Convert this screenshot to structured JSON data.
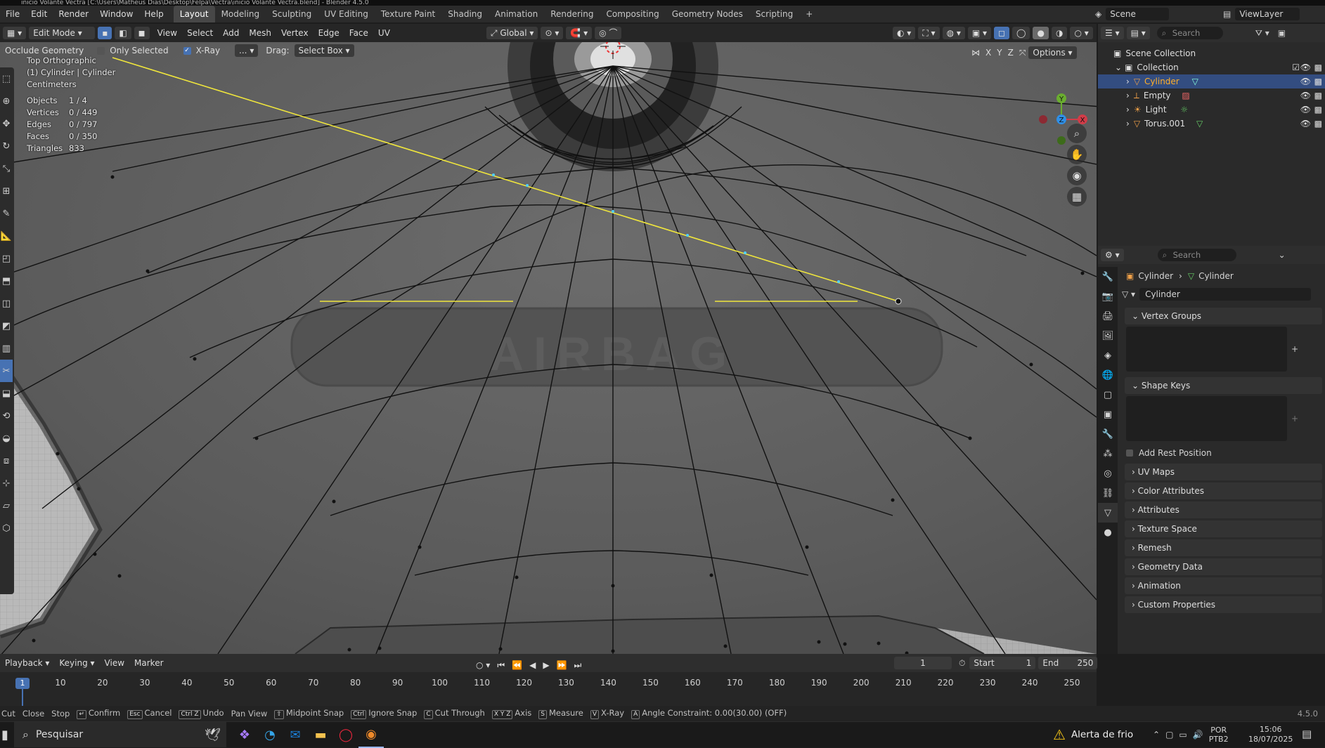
{
  "titlebar": "inicio Volante Vectra [C:\\Users\\Matheus Dias\\Desktop\\Felpa\\Vectra\\inicio Volante Vectra.blend] - Blender 4.5.0",
  "menus": [
    "File",
    "Edit",
    "Render",
    "Window",
    "Help"
  ],
  "workspaces": [
    "Layout",
    "Modeling",
    "Sculpting",
    "UV Editing",
    "Texture Paint",
    "Shading",
    "Animation",
    "Rendering",
    "Compositing",
    "Geometry Nodes",
    "Scripting"
  ],
  "active_workspace": "Layout",
  "scene": {
    "name": "Scene",
    "view_layer": "ViewLayer"
  },
  "viewport_header": {
    "mode": "Edit Mode",
    "menus": [
      "View",
      "Select",
      "Add",
      "Mesh",
      "Vertex",
      "Edge",
      "Face",
      "UV"
    ],
    "orientation": "Global",
    "options_label": "Options"
  },
  "tool_header": {
    "occlude": "Occlude Geometry",
    "only_selected": "Only Selected",
    "xray": "X-Ray",
    "ellipsis": "...",
    "drag_label": "Drag:",
    "drag_value": "Select Box"
  },
  "axis_labels": [
    "X",
    "Y",
    "Z"
  ],
  "overlay_info": {
    "view": "Top Orthographic",
    "object": "(1) Cylinder | Cylinder",
    "units": "Centimeters",
    "stats": [
      {
        "label": "Objects",
        "value": "1 / 4"
      },
      {
        "label": "Vertices",
        "value": "0 / 449"
      },
      {
        "label": "Edges",
        "value": "0 / 797"
      },
      {
        "label": "Faces",
        "value": "0 / 350"
      },
      {
        "label": "Triangles",
        "value": "833"
      }
    ]
  },
  "viewport_text": "AIRBAG",
  "outliner": {
    "search_placeholder": "Search",
    "scene_collection": "Scene Collection",
    "collection": "Collection",
    "items": [
      {
        "name": "Cylinder",
        "icon": "mesh-icon",
        "selected": true
      },
      {
        "name": "Empty",
        "icon": "empty-icon",
        "selected": false
      },
      {
        "name": "Light",
        "icon": "light-icon",
        "selected": false
      },
      {
        "name": "Torus.001",
        "icon": "mesh-icon",
        "selected": false
      }
    ]
  },
  "properties": {
    "search_placeholder": "Search",
    "breadcrumb": [
      "Cylinder",
      "Cylinder"
    ],
    "data_name": "Cylinder",
    "vertex_groups": "Vertex Groups",
    "shape_keys": "Shape Keys",
    "add_rest_position": "Add Rest Position",
    "panels": [
      "UV Maps",
      "Color Attributes",
      "Attributes",
      "Texture Space",
      "Remesh",
      "Geometry Data",
      "Animation",
      "Custom Properties"
    ]
  },
  "timeline": {
    "menus": [
      "Playback",
      "Keying",
      "View",
      "Marker"
    ],
    "current_frame": "1",
    "start_label": "Start",
    "start": "1",
    "end_label": "End",
    "end": "250",
    "ticks": [
      "10",
      "20",
      "30",
      "40",
      "50",
      "60",
      "70",
      "80",
      "90",
      "100",
      "110",
      "120",
      "130",
      "140",
      "150",
      "160",
      "170",
      "180",
      "190",
      "200",
      "210",
      "220",
      "230",
      "240",
      "250"
    ],
    "playhead": "1"
  },
  "statusbar": [
    {
      "key": "",
      "label": "Cut"
    },
    {
      "key": "",
      "label": "Close"
    },
    {
      "key": "",
      "label": "Stop"
    },
    {
      "key": "↵",
      "label": "Confirm"
    },
    {
      "key": "Esc",
      "label": "Cancel"
    },
    {
      "key": "Ctrl Z",
      "label": "Undo"
    },
    {
      "key": "",
      "label": "Pan View"
    },
    {
      "key": "⇧",
      "label": "Midpoint Snap"
    },
    {
      "key": "Ctrl",
      "label": "Ignore Snap"
    },
    {
      "key": "C",
      "label": "Cut Through"
    },
    {
      "key": "X Y Z",
      "label": "Axis"
    },
    {
      "key": "S",
      "label": "Measure"
    },
    {
      "key": "V",
      "label": "X-Ray"
    },
    {
      "key": "A",
      "label": "Angle Constraint: 0.00(30.00) (OFF)"
    }
  ],
  "version": "4.5.0",
  "taskbar": {
    "search": "Pesquisar",
    "weather": "Alerta de frio",
    "lang1": "POR",
    "lang2": "PTB2",
    "time": "15:06",
    "date": "18/07/2025"
  },
  "colors": {
    "accent": "#4772b3",
    "knife": "#e8e23c",
    "selection": "#334d80"
  }
}
